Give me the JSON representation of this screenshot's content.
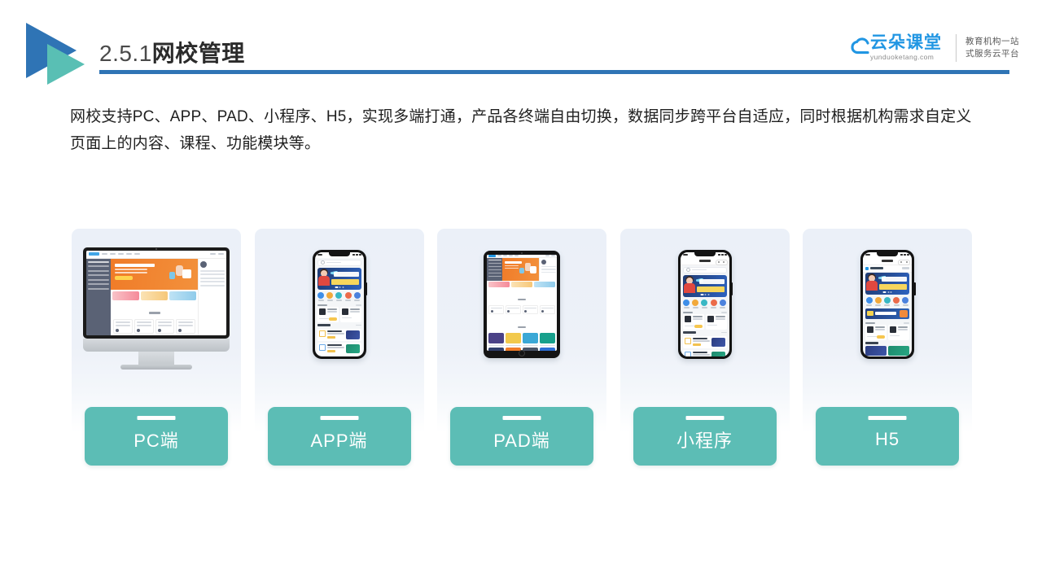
{
  "header": {
    "section_number": "2.5.1",
    "title_zh": "网校管理",
    "logo_icon": "double-triangle-play-icon",
    "accent_blue": "#2F74B5",
    "accent_teal": "#59BFB4"
  },
  "brand": {
    "cloud_icon": "cloud-icon",
    "name_cn": "云朵课堂",
    "name_en": "yunduoketang.com",
    "tagline_line1": "教育机构一站",
    "tagline_line2": "式服务云平台",
    "brand_color": "#2196E3"
  },
  "intro": {
    "paragraph": "网校支持PC、APP、PAD、小程序、H5，实现多端打通，产品各终端自由切换，数据同步跨平台自适应，同时根据机构需求自定义页面上的内容、课程、功能模块等。"
  },
  "cards": {
    "label_bg": "#5CBDB5",
    "card_bg": "#EBF0F8",
    "items": [
      {
        "id": "pc",
        "label": "PC端",
        "device": "desktop-monitor"
      },
      {
        "id": "app",
        "label": "APP端",
        "device": "smartphone"
      },
      {
        "id": "pad",
        "label": "PAD端",
        "device": "tablet"
      },
      {
        "id": "mini",
        "label": "小程序",
        "device": "smartphone-miniprogram"
      },
      {
        "id": "h5",
        "label": "H5",
        "device": "smartphone-browser"
      }
    ]
  }
}
